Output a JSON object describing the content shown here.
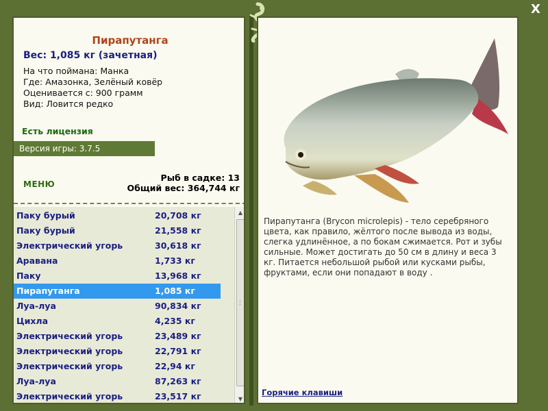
{
  "fish": {
    "title": "Пирапутанга",
    "weight_line": "Вес: 1,085 кг (зачетная)",
    "bait_line": "На что поймана: Манка",
    "location_line": "Где: Амазонка, Зелёный ковёр",
    "valued_line": "Оценивается с: 900 грамм",
    "rarity_line": "Вид: Ловится редко",
    "description": "Пирапутанга (Brycon microlepis) - тело серебряного цвета, как правило, жёлтого после вывода из воды, слегка удлинённое, а по бокам сжимается. Рот и зубы сильные. Может достигать до 50 см в длину и веса 3 кг. Питается небольшой рыбой или кусками рыбы, фруктами, если они попадают в воду ."
  },
  "license": "Есть лицензия",
  "version": "Версия игры: 3.7.5",
  "menu_label": "МЕНЮ",
  "stats": {
    "count_line": "Рыб в садке: 13",
    "total_line": "Общий вес: 364,744 кг"
  },
  "catch_list": [
    {
      "name": "Паку бурый",
      "weight": "20,708 кг"
    },
    {
      "name": "Паку бурый",
      "weight": "21,558 кг"
    },
    {
      "name": "Электрический угорь",
      "weight": "30,618 кг"
    },
    {
      "name": "Аравана",
      "weight": "1,733 кг"
    },
    {
      "name": "Паку",
      "weight": "13,968 кг"
    },
    {
      "name": "Пирапутанга",
      "weight": "1,085 кг"
    },
    {
      "name": "Луа-луа",
      "weight": "90,834 кг"
    },
    {
      "name": "Цихла",
      "weight": "4,235 кг"
    },
    {
      "name": "Электрический угорь",
      "weight": "23,489 кг"
    },
    {
      "name": "Электрический угорь",
      "weight": "22,791 кг"
    },
    {
      "name": "Электрический угорь",
      "weight": "22,94 кг"
    },
    {
      "name": "Луа-луа",
      "weight": "87,263 кг"
    },
    {
      "name": "Электрический угорь",
      "weight": "23,517 кг"
    }
  ],
  "selected_index": 5,
  "hotkeys_label": "Горячие клавиши",
  "close_label": "X",
  "colors": {
    "frame": "#5c7034",
    "title": "#b0441a",
    "list_text": "#1a1f80",
    "selection": "#3399ee",
    "license": "#1b6a12"
  }
}
